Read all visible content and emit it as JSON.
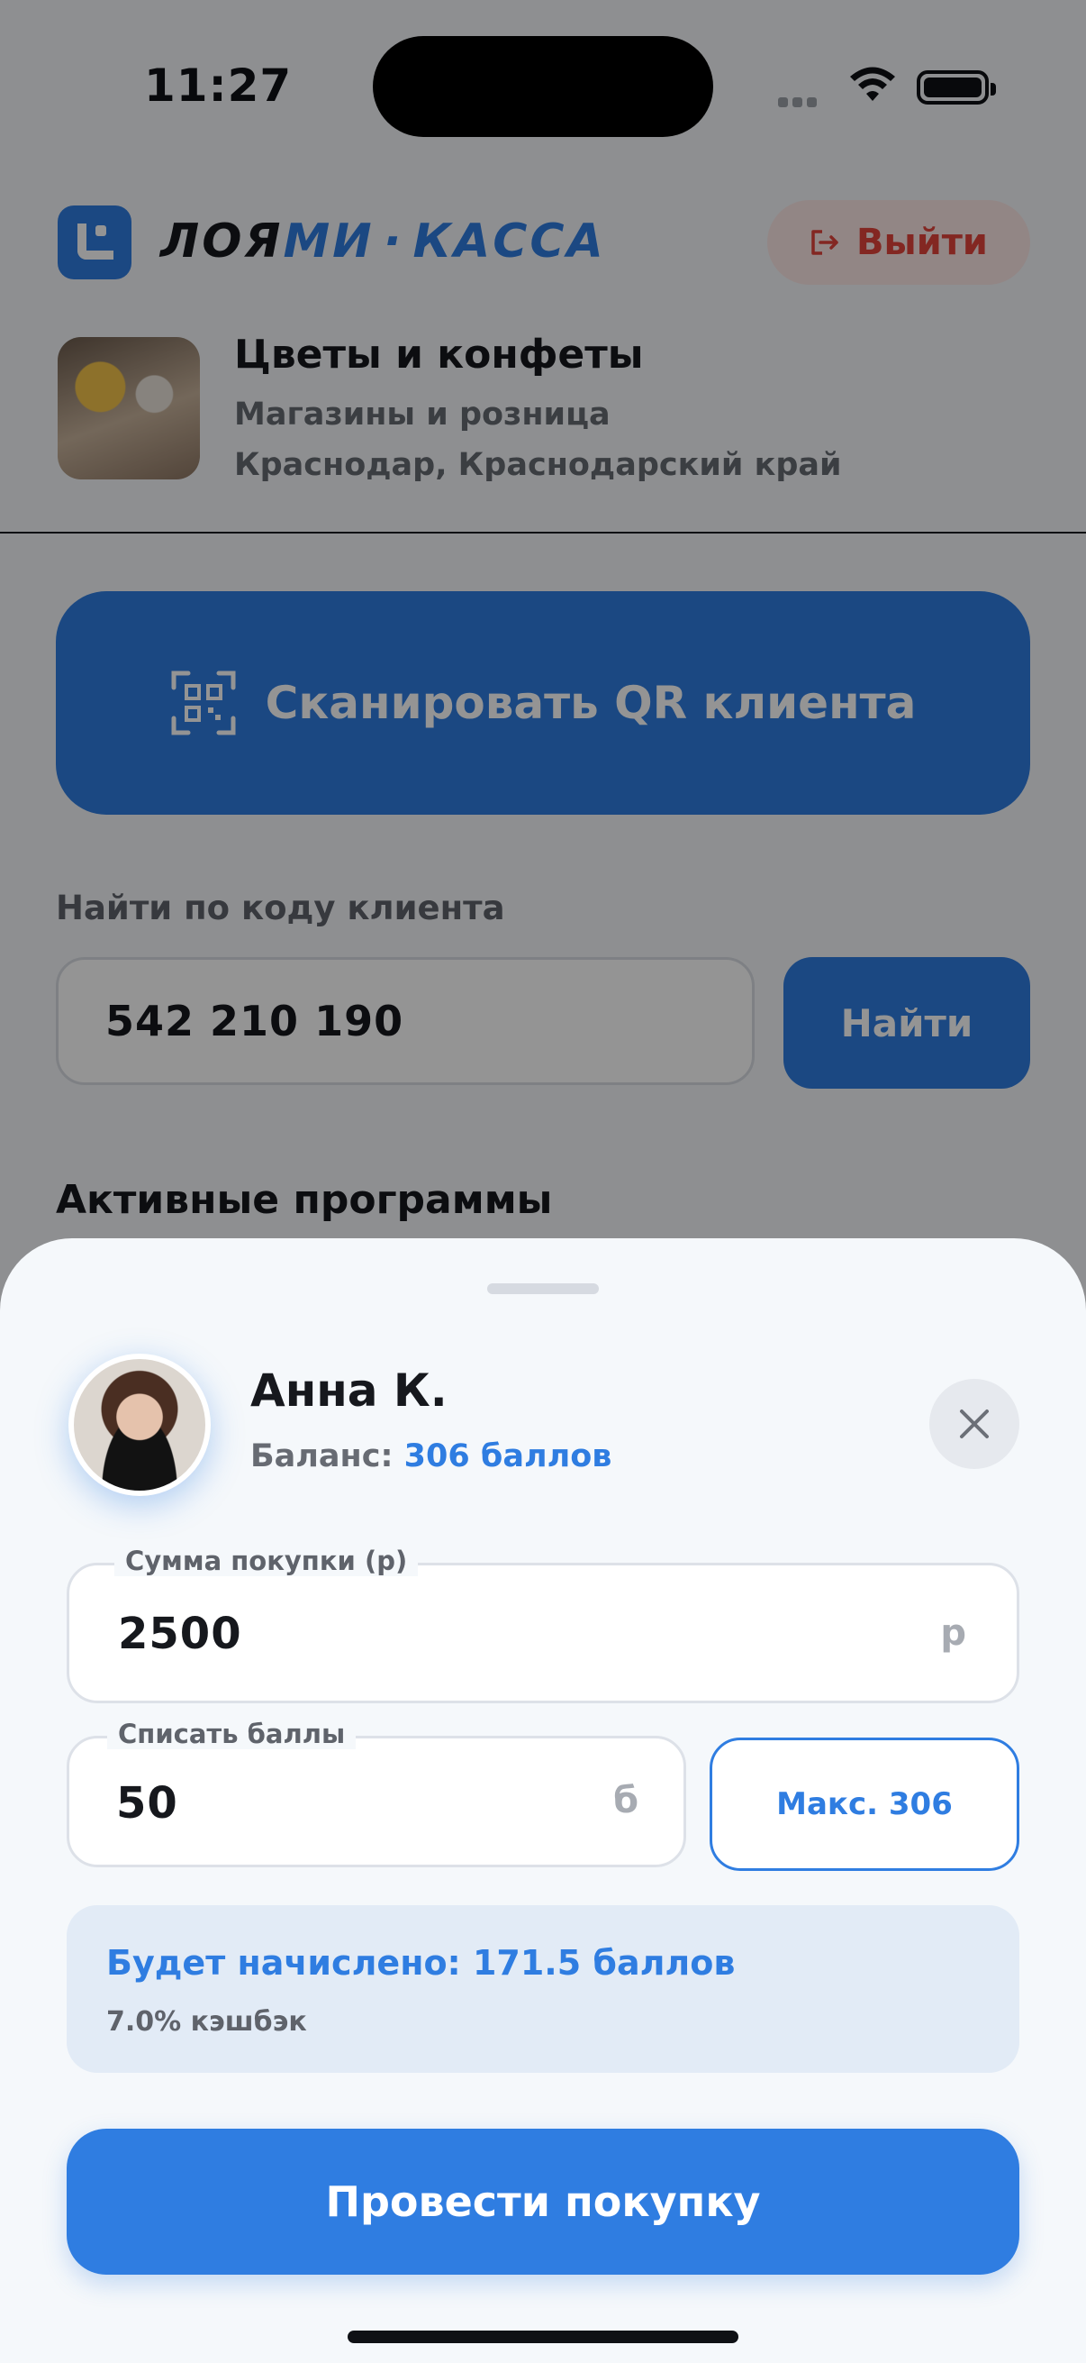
{
  "status_bar": {
    "time": "11:27"
  },
  "header": {
    "brand_part1": "ЛОЯ",
    "brand_part2": "МИ",
    "brand_sep": "·",
    "brand_part3": "КАССА",
    "logout_label": "Выйти",
    "logout_icon": "logout-icon",
    "colors": {
      "accent": "#2f7de1",
      "danger": "#e2443b"
    }
  },
  "shop": {
    "name": "Цветы и конфеты",
    "category": "Магазины и розница",
    "location": "Краснодар, Краснодарский край"
  },
  "scan": {
    "label": "Сканировать QR клиента",
    "icon": "qr-scan-icon"
  },
  "find": {
    "label": "Найти по коду клиента",
    "code_value": "542 210 190",
    "button_label": "Найти"
  },
  "programs": {
    "title": "Активные программы"
  },
  "sheet": {
    "customer": {
      "name": "Анна К.",
      "balance_label": "Баланс:",
      "balance_value": "306 баллов"
    },
    "close_icon": "close-icon",
    "purchase_sum": {
      "legend": "Сумма покупки (р)",
      "value": "2500",
      "unit": "р"
    },
    "redeem_points": {
      "legend": "Списать баллы",
      "value": "50",
      "unit": "б"
    },
    "max_button_label": "Макс. 306",
    "accrual": {
      "main": "Будет начислено: 171.5 баллов",
      "sub": "7.0% кэшбэк"
    },
    "submit_label": "Провести покупку"
  }
}
